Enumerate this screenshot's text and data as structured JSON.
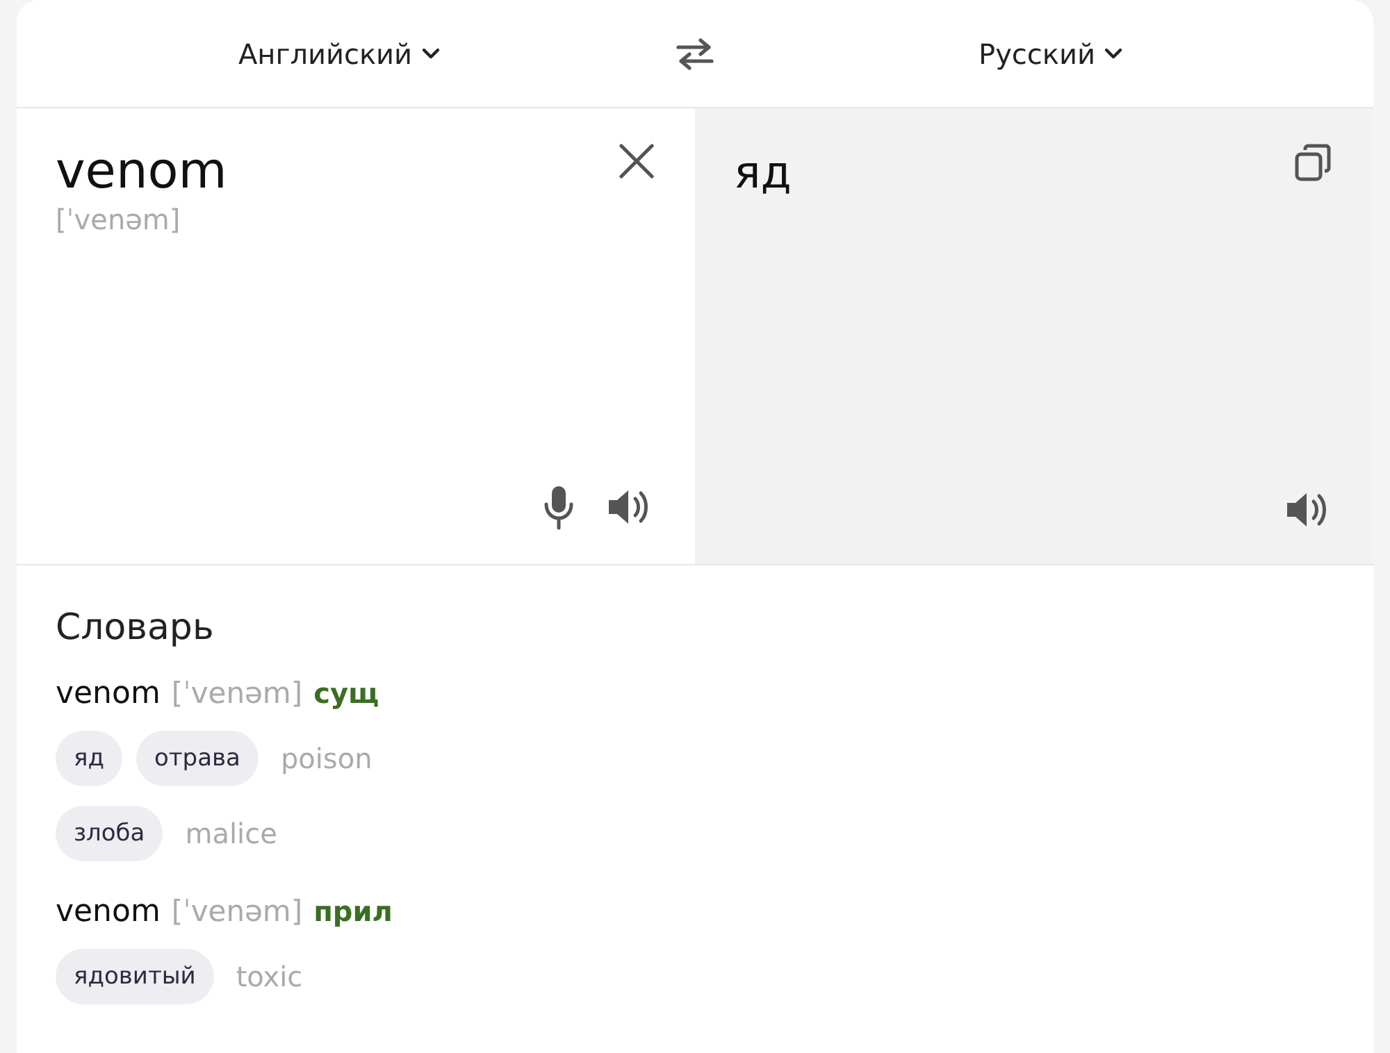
{
  "languages": {
    "source": "Английский",
    "target": "Русский"
  },
  "source": {
    "text": "venom",
    "transcription": "[ˈvenəm]"
  },
  "translation": {
    "text": "яд"
  },
  "dictionary": {
    "title": "Словарь",
    "entries": [
      {
        "word": "venom",
        "transcription": "[ˈvenəm]",
        "pos": "сущ",
        "rows": [
          {
            "translations": [
              "яд",
              "отрава"
            ],
            "synonym": "poison"
          },
          {
            "translations": [
              "злоба"
            ],
            "synonym": "malice"
          }
        ]
      },
      {
        "word": "venom",
        "transcription": "[ˈvenəm]",
        "pos": "прил",
        "rows": [
          {
            "translations": [
              "ядовитый"
            ],
            "synonym": "toxic"
          }
        ]
      }
    ]
  }
}
